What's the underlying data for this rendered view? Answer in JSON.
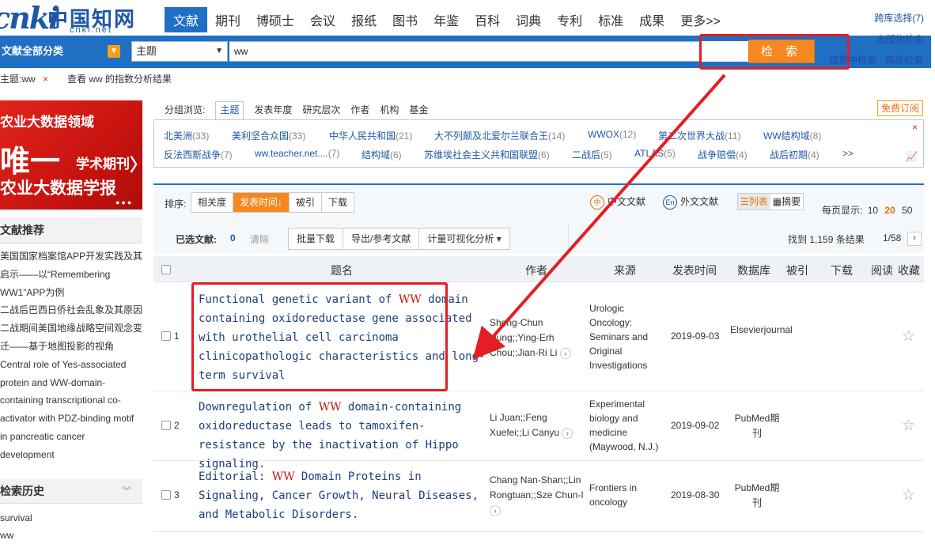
{
  "logo": {
    "main": "cnki",
    "cn": "中国知网",
    "sub": "cnki.net"
  },
  "nav": [
    "文献",
    "期刊",
    "博硕士",
    "会议",
    "报纸",
    "图书",
    "年鉴",
    "百科",
    "词典",
    "专利",
    "标准",
    "成果",
    "更多>>"
  ],
  "top_right": {
    "cross_select": "跨库选择(7)",
    "publication_search": "出版物检索"
  },
  "search": {
    "category_label": "文献全部分类",
    "field": "主题",
    "query": "ww",
    "button": "检 索",
    "search_in_results": "结果中检索",
    "advanced": "高级检索"
  },
  "under_bar": {
    "tag": "主题:ww",
    "tag_close": "×",
    "index_link": "查看 ww 的指数分析结果"
  },
  "banner": {
    "line1": "农业大数据领域",
    "line2": "唯一",
    "line3": "学术期刊",
    "line4": "农业大数据学报",
    "chev": "〉",
    "dots": "●●●"
  },
  "sidebar": {
    "recommend_title": "文献推荐",
    "recommend": [
      "美国国家档案馆APP开发实践及其",
      "启示——以“Remembering",
      "WW1”APP为例",
      "二战后巴西日侨社会乱象及其原因",
      "二战期间美国地缘战略空间观念变",
      "迁——基于地图投影的视角",
      "Central role of Yes-associated",
      "protein and WW-domain-",
      "containing transcriptional co-",
      "activator with PDZ-binding motif",
      "in pancreatic cancer",
      "development"
    ],
    "history_title": "检索历史",
    "history_chev": "︾",
    "history": [
      "survival",
      "ww"
    ]
  },
  "group_tabs": {
    "label": "分组浏览:",
    "tabs": [
      "主题",
      "发表年度",
      "研究层次",
      "作者",
      "机构",
      "基金"
    ],
    "free_sub": "免费订阅"
  },
  "groups_row1": [
    {
      "name": "北美洲",
      "count": "(33)"
    },
    {
      "name": "美利坚合众国",
      "count": "(33)"
    },
    {
      "name": "中华人民共和国",
      "count": "(21)"
    },
    {
      "name": "大不列颠及北爱尔兰联合王",
      "count": "(14)"
    },
    {
      "name": "WWOX",
      "count": "(12)"
    },
    {
      "name": "第二次世界大战",
      "count": "(11)"
    },
    {
      "name": "WW结构域",
      "count": "(8)"
    }
  ],
  "groups_row2": [
    {
      "name": "反法西斯战争",
      "count": "(7)"
    },
    {
      "name": "ww.teacher.net....",
      "count": "(7)"
    },
    {
      "name": "结构域",
      "count": "(6)"
    },
    {
      "name": "苏维埃社会主义共和国联盟",
      "count": "(6)"
    },
    {
      "name": "二战后",
      "count": "(5)"
    },
    {
      "name": "ATLAS",
      "count": "(5)"
    },
    {
      "name": "战争赔偿",
      "count": "(4)"
    },
    {
      "name": "战后初期",
      "count": "(4)"
    }
  ],
  "groups_more": ">>",
  "groups_close": "×",
  "groups_chart": "📈",
  "sort": {
    "label": "排序:",
    "options": [
      "相关度",
      "发表时间↓",
      "被引",
      "下载"
    ]
  },
  "lang": {
    "cn_icon": "中",
    "cn": "中文文献",
    "en_icon": "En",
    "en": "外文文献"
  },
  "view": {
    "list": "☰列表",
    "abstract": "▦摘要"
  },
  "per_page": {
    "label": "每页显示:",
    "opts": [
      "10",
      "20",
      "50"
    ]
  },
  "selection": {
    "label": "已选文献:",
    "count": "0",
    "clear": "清除"
  },
  "actions": [
    "批量下载",
    "导出/参考文献",
    "计量可视化分析 ▾"
  ],
  "found": "找到 1,159 条结果",
  "pagination": {
    "current": "1/58",
    "next": "›"
  },
  "table_headers": [
    "题名",
    "作者",
    "来源",
    "发表时间",
    "数据库",
    "被引",
    "下载",
    "阅读",
    "收藏"
  ],
  "rows": [
    {
      "num": "1",
      "title_pre": "Functional genetic variant of ",
      "title_hl": "WW",
      "title_post": " domain containing oxidoreductase gene associated with urothelial cell carcinoma clinicopathologic characteristics and long-term survival",
      "authors": "Sheng-Chun Hung;;Ying-Erh Chou;;Jian-Ri Li",
      "source": "Urologic Oncology: Seminars and Original Investigations",
      "date": "2019-09-03",
      "db": "Elsevierjournal"
    },
    {
      "num": "2",
      "title_pre": "Downregulation of ",
      "title_hl": "WW",
      "title_post": " domain-containing oxidoreductase leads to tamoxifen-resistance by the inactivation of Hippo signaling.",
      "authors": "Li Juan;;Feng Xuefei;;Li Canyu",
      "source": "Experimental biology and medicine (Maywood, N.J.)",
      "date": "2019-09-02",
      "db": "PubMed期刊"
    },
    {
      "num": "3",
      "title_pre": "Editorial: ",
      "title_hl": "WW",
      "title_post": " Domain Proteins in Signaling, Cancer Growth, Neural Diseases, and Metabolic Disorders.",
      "authors": "Chang Nan-Shan;;Lin Rongtuan;;Sze Chun-I",
      "source": "Frontiers in oncology",
      "date": "2019-08-30",
      "db": "PubMed期刊"
    }
  ],
  "author_more": "›",
  "star": "☆",
  "colors": {
    "nav_blue": "#1f6fc5",
    "search_orange": "#f6881f",
    "annotation_red": "#e31e24"
  }
}
